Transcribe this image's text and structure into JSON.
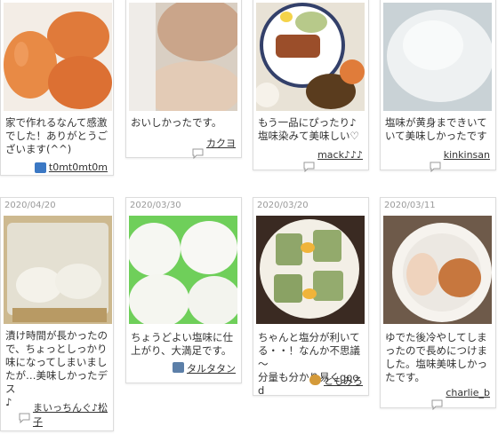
{
  "cards": [
    {
      "date": "",
      "comment": "家で作れるなんて感激\nでした！ありがとうご\nざいます(^^)",
      "user": "t0mt0mt0m",
      "avatar": "avatar-photo-icon"
    },
    {
      "date": "",
      "comment": "おいしかったです。",
      "user": "カクヨ",
      "avatar": "speech-bubble-icon"
    },
    {
      "date": "",
      "comment": "もう一品にぴったり♪\n塩味染みて美味しい♡",
      "user": "mack♪♪♪",
      "avatar": "speech-bubble-icon"
    },
    {
      "date": "",
      "comment": "塩味が黄身まできいて\nいて美味しかったです",
      "user": "kinkinsan",
      "avatar": "speech-bubble-icon"
    },
    {
      "date": "2020/04/20",
      "comment": "漬け時間が長かったの\nで、ちょっとしっかり\n味になってしまいまし\nたが…美味しかったデス\n♪",
      "user": "まいっちんぐ♪松\n子",
      "avatar": "speech-bubble-icon"
    },
    {
      "date": "2020/03/30",
      "comment": "ちょうどよい塩味に仕\n上がり、大満足です。",
      "user": "タルタタン",
      "avatar": "avatar-photo-icon"
    },
    {
      "date": "2020/03/20",
      "comment": "ちゃんと塩分が利いて\nる・・！なんか不思議～\n分量も分かり易くgood",
      "user": "ともみろ",
      "avatar": "avatar-photo-icon"
    },
    {
      "date": "2020/03/11",
      "comment": "ゆでた後冷やしてしま\nったので長めにつけま\nした。塩味美味しかっ\nたです。",
      "user": "charlie_b",
      "avatar": "speech-bubble-icon"
    }
  ]
}
